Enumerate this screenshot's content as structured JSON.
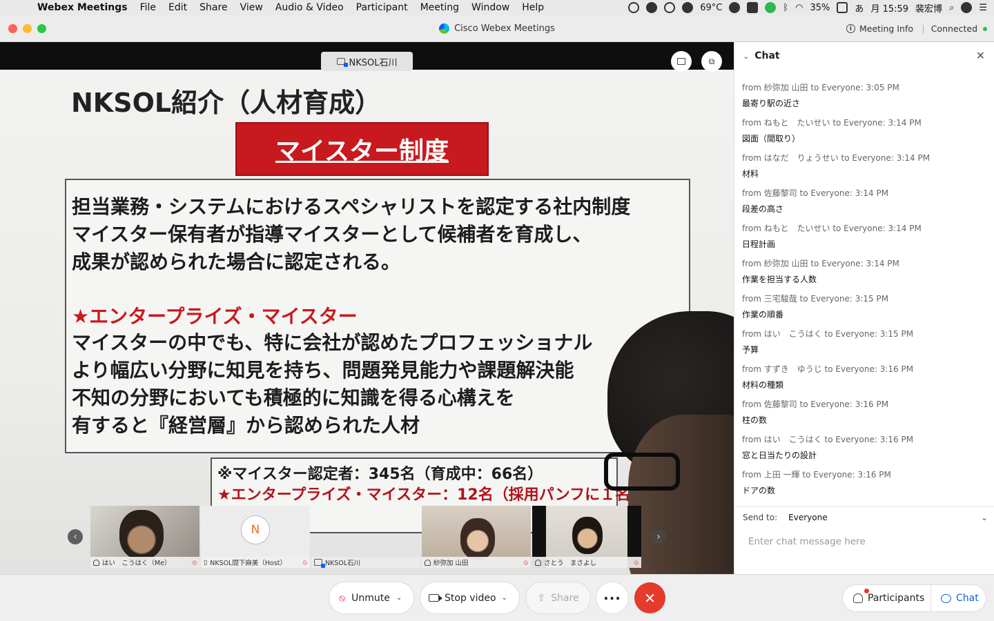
{
  "menubar": {
    "app_name": "Webex Meetings",
    "menus": [
      "File",
      "Edit",
      "Share",
      "View",
      "Audio & Video",
      "Participant",
      "Meeting",
      "Window",
      "Help"
    ],
    "temperature": "69°C",
    "battery": "35%",
    "ime": "あ",
    "clock": "月 15:59",
    "user": "裴宏博"
  },
  "window": {
    "title": "Cisco Webex Meetings",
    "meeting_info": "Meeting Info",
    "status": "Connected"
  },
  "stage": {
    "sharer": "NKSOL石川",
    "slide": {
      "title": "NKSOL紹介（人材育成）",
      "banner": "マイスター制度",
      "lines": [
        "担当業務・システムにおけるスペシャリストを認定する社内制度",
        "マイスター保有者が指導マイスターとして候補者を育成し、",
        "成果が認められた場合に認定される。"
      ],
      "subheading": "★エンタープライズ・マイスター",
      "sublines": [
        "マイスターの中でも、特に会社が認めたプロフェッショナル",
        "より幅広い分野に知見を持ち、問題発見能力や課題解決能",
        "不知の分野においても積極的に知識を得る心構えを",
        "有すると『経営層』から認められた人材"
      ],
      "note1": "※マイスター認定者：345名（育成中：66名）",
      "note2": "★エンタープライズ・マイスター：12名（採用パンフに１名"
    }
  },
  "filmstrip": [
    {
      "name": "はい　こうはく（Me）"
    },
    {
      "name": "NKSOL間下麻美（Host）",
      "avatar": "N"
    },
    {
      "name": "NKSOL石川"
    },
    {
      "name": "紗弥加 山田"
    },
    {
      "name": "さとう　まさよし"
    }
  ],
  "chat": {
    "title": "Chat",
    "messages": [
      {
        "meta": "from 紗弥加 山田 to Everyone:   3:05  PM",
        "text": "最寄り駅の近さ"
      },
      {
        "meta": "from ねもと　たいせい to Everyone:   3:14  PM",
        "text": "図面（間取り）"
      },
      {
        "meta": "from はなだ　りょうせい to Everyone:   3:14  PM",
        "text": "材料"
      },
      {
        "meta": "from 佐藤黎司 to Everyone:   3:14  PM",
        "text": "段差の高さ"
      },
      {
        "meta": "from ねもと　たいせい to Everyone:   3:14  PM",
        "text": "日程計画"
      },
      {
        "meta": "from 紗弥加 山田 to Everyone:   3:14  PM",
        "text": "作業を担当する人数"
      },
      {
        "meta": "from 三宅駿哉 to Everyone:   3:15  PM",
        "text": "作業の順番"
      },
      {
        "meta": "from はい　こうはく to Everyone:   3:15  PM",
        "text": "予算"
      },
      {
        "meta": "from すずき　ゆうじ to Everyone:   3:16  PM",
        "text": "材料の種類"
      },
      {
        "meta": "from 佐藤黎司 to Everyone:   3:16  PM",
        "text": "柱の数"
      },
      {
        "meta": "from はい　こうはく to Everyone:   3:16  PM",
        "text": "窓と日当たりの設計"
      },
      {
        "meta": "from 上田 一輝 to Everyone:   3:16  PM",
        "text": "ドアの数"
      }
    ],
    "send_to_label": "Send to:",
    "send_to_value": "Everyone",
    "input_placeholder": "Enter chat message here"
  },
  "controls": {
    "unmute": "Unmute",
    "stop_video": "Stop video",
    "share": "Share",
    "more": "···",
    "end": "✕",
    "participants": "Participants",
    "chat": "Chat"
  },
  "colors": {
    "end_button": "#e53a2e",
    "accent_blue": "#0a60d8",
    "slide_banner": "#c8191e"
  }
}
